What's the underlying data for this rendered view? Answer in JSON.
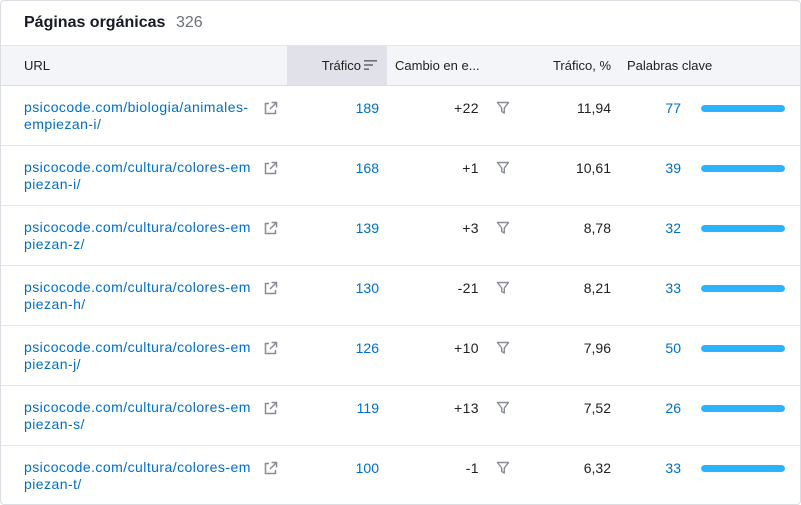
{
  "header": {
    "title": "Páginas orgánicas",
    "count": "326"
  },
  "columns": {
    "url": "URL",
    "traffic": "Tráfico",
    "change": "Cambio en e...",
    "traffic_pct": "Tráfico, %",
    "keywords": "Palabras clave"
  },
  "icons": {
    "sort": "sort-descending-icon",
    "external": "external-link-icon",
    "filter": "filter-funnel-icon"
  },
  "colors": {
    "link": "#006dca",
    "bar": "#2bb3ff",
    "header_bg": "#f4f5f9",
    "sorted_col_bg": "#e0e1e9"
  },
  "rows": [
    {
      "url": "psicocode.com/biologia/animales-empiezan-i/",
      "traffic": "189",
      "change": "+22",
      "traffic_pct": "11,94",
      "keywords": "77",
      "keywords_bar_fraction": 1.0
    },
    {
      "url": "psicocode.com/cultura/colores-empiezan-i/",
      "traffic": "168",
      "change": "+1",
      "traffic_pct": "10,61",
      "keywords": "39",
      "keywords_bar_fraction": 1.0
    },
    {
      "url": "psicocode.com/cultura/colores-empiezan-z/",
      "traffic": "139",
      "change": "+3",
      "traffic_pct": "8,78",
      "keywords": "32",
      "keywords_bar_fraction": 1.0
    },
    {
      "url": "psicocode.com/cultura/colores-empiezan-h/",
      "traffic": "130",
      "change": "-21",
      "traffic_pct": "8,21",
      "keywords": "33",
      "keywords_bar_fraction": 1.0
    },
    {
      "url": "psicocode.com/cultura/colores-empiezan-j/",
      "traffic": "126",
      "change": "+10",
      "traffic_pct": "7,96",
      "keywords": "50",
      "keywords_bar_fraction": 1.0
    },
    {
      "url": "psicocode.com/cultura/colores-empiezan-s/",
      "traffic": "119",
      "change": "+13",
      "traffic_pct": "7,52",
      "keywords": "26",
      "keywords_bar_fraction": 1.0
    },
    {
      "url": "psicocode.com/cultura/colores-empiezan-t/",
      "traffic": "100",
      "change": "-1",
      "traffic_pct": "6,32",
      "keywords": "33",
      "keywords_bar_fraction": 1.0
    }
  ]
}
